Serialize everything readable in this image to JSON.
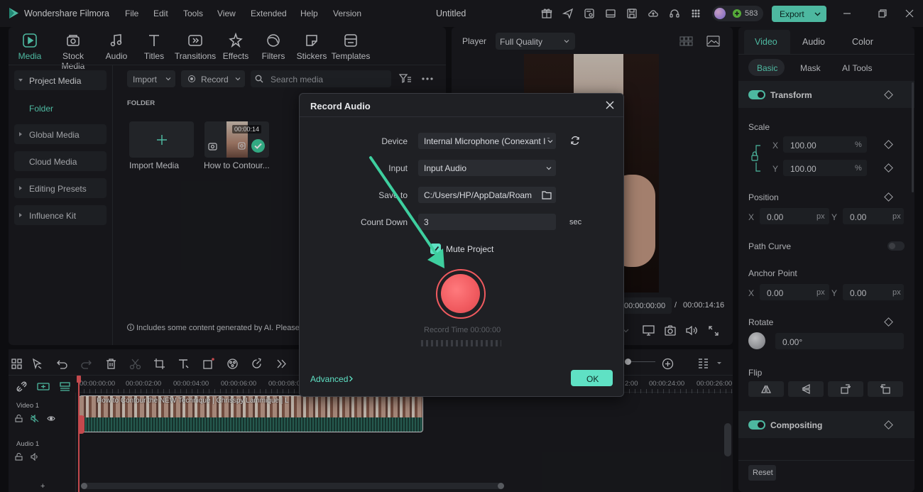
{
  "app": {
    "name": "Wondershare Filmora",
    "document_title": "Untitled",
    "menu": [
      "File",
      "Edit",
      "Tools",
      "View",
      "Extended",
      "Help",
      "Version"
    ],
    "credits": "583",
    "export_label": "Export",
    "accent_color": "#5fe1c4"
  },
  "media_tabs": [
    {
      "label": "Media",
      "icon": "media-icon",
      "active": true
    },
    {
      "label": "Stock Media",
      "icon": "stock-media-icon"
    },
    {
      "label": "Audio",
      "icon": "music-note-icon"
    },
    {
      "label": "Titles",
      "icon": "text-icon"
    },
    {
      "label": "Transitions",
      "icon": "transitions-icon"
    },
    {
      "label": "Effects",
      "icon": "effects-icon"
    },
    {
      "label": "Filters",
      "icon": "filters-icon"
    },
    {
      "label": "Stickers",
      "icon": "stickers-icon"
    },
    {
      "label": "Templates",
      "icon": "templates-icon"
    }
  ],
  "sidebar": {
    "items": [
      "Project Media",
      "Folder",
      "Global Media",
      "Cloud Media",
      "Editing Presets",
      "Influence Kit"
    ]
  },
  "media_toolbar": {
    "import_label": "Import",
    "record_label": "Record",
    "search_placeholder": "Search media"
  },
  "media_area": {
    "folder_label": "FOLDER",
    "import_tile_label": "Import Media",
    "clip_label": "How to Contour...",
    "clip_duration": "00:00:14",
    "ai_notice": "Includes some content generated by AI. Please"
  },
  "player": {
    "label": "Player",
    "quality": "Full Quality",
    "current_time": "00:00:00:00",
    "separator": "/",
    "total_time": "00:00:14:16"
  },
  "props": {
    "tabs": [
      "Video",
      "Audio",
      "Color"
    ],
    "subtabs": [
      "Basic",
      "Mask",
      "AI Tools"
    ],
    "transform_label": "Transform",
    "scale_label": "Scale",
    "scale_x": "100.00",
    "scale_y": "100.00",
    "percent": "%",
    "x_label": "X",
    "y_label": "Y",
    "position_label": "Position",
    "position_x": "0.00",
    "position_y": "0.00",
    "px": "px",
    "path_curve_label": "Path Curve",
    "anchor_label": "Anchor Point",
    "anchor_x": "0.00",
    "anchor_y": "0.00",
    "rotate_label": "Rotate",
    "rotate_value": "0.00°",
    "flip_label": "Flip",
    "compositing_label": "Compositing",
    "reset_label": "Reset"
  },
  "timeline": {
    "timecodes": [
      "00:00:00:00",
      "00:00:02:00",
      "00:00:04:00",
      "00:00:06:00",
      "00:00:08:0"
    ],
    "timecodes_right": [
      "2:00",
      "00:00:24:00",
      "00:00:26:00"
    ],
    "video_track": "Video 1",
    "audio_track": "Audio 1",
    "clip_title": "How to Contour the NEW Technique | Chrisspy Lammique | L"
  },
  "dialog": {
    "title": "Record Audio",
    "device_label": "Device",
    "device_value": "Internal Microphone (Conexant IS:",
    "input_label": "Input",
    "input_value": "Input Audio",
    "save_label": "Save to",
    "save_value": "C:/Users/HP/AppData/Roam",
    "countdown_label": "Count Down",
    "countdown_value": "3",
    "countdown_unit": "sec",
    "mute_label": "Mute Project",
    "mute_checked": true,
    "record_time": "Record Time 00:00:00",
    "advanced_label": "Advanced",
    "ok_label": "OK",
    "record_color": "#f05a5f"
  }
}
